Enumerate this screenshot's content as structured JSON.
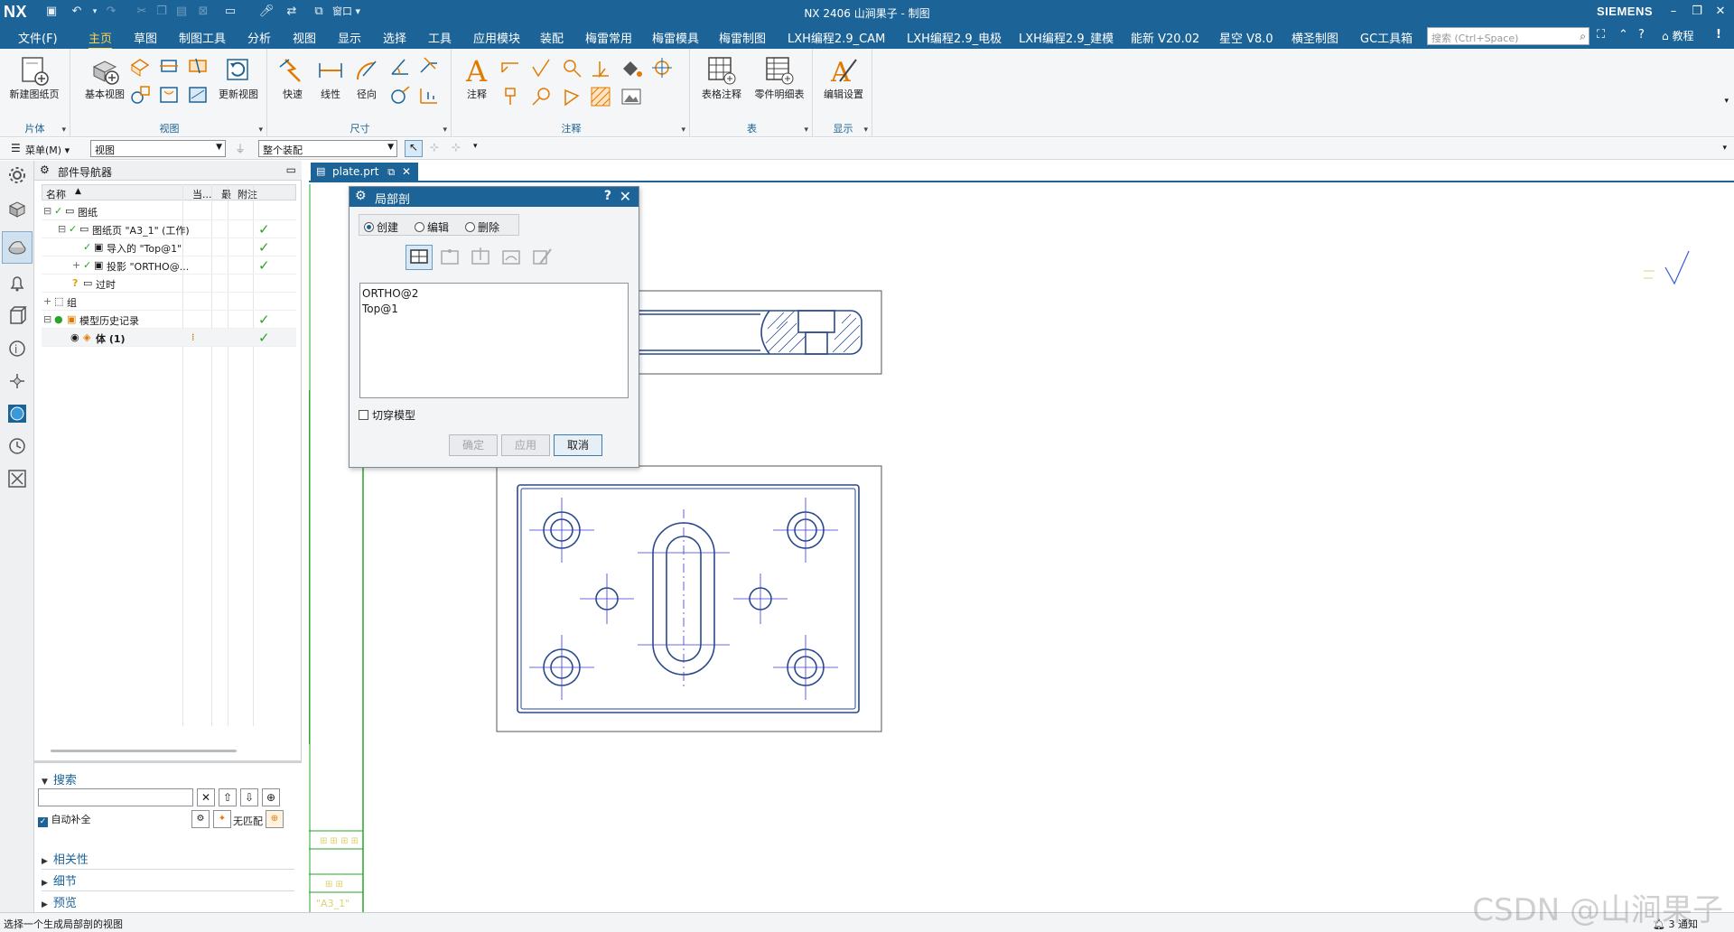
{
  "app": {
    "logo": "NX",
    "window_title": "NX 2406 山涧果子 - 制图",
    "brand": "SIEMENS",
    "window_menu": "窗口",
    "colors": {
      "primary": "#1c6497",
      "accent": "#ffd24a",
      "check": "#2aa32a",
      "drawing": "#2a4a8a",
      "view_border": "#555555"
    }
  },
  "menubar": {
    "items": [
      "文件(F)",
      "主页",
      "草图",
      "制图工具",
      "分析",
      "视图",
      "显示",
      "选择",
      "工具",
      "应用模块",
      "装配",
      "梅雷常用",
      "梅雷模具",
      "梅雷制图",
      "LXH编程2.9_CAM",
      "LXH编程2.9_电极",
      "LXH编程2.9_建模",
      "能新 V20.02",
      "星空 V8.0",
      "横圣制图",
      "GC工具箱"
    ],
    "active": "主页",
    "search_placeholder": "搜索 (Ctrl+Space)",
    "tutorial": "教程"
  },
  "ribbon": {
    "groups": [
      {
        "label": "片体",
        "buttons": [
          "新建图纸页"
        ]
      },
      {
        "label": "视图",
        "buttons": [
          "基本视图",
          "更新视图"
        ]
      },
      {
        "label": "尺寸",
        "buttons": [
          "快速",
          "线性",
          "径向"
        ]
      },
      {
        "label": "注释",
        "buttons": [
          "注释"
        ]
      },
      {
        "label": "表",
        "buttons": [
          "表格注释",
          "零件明细表"
        ]
      },
      {
        "label": "显示",
        "buttons": [
          "编辑设置"
        ]
      }
    ]
  },
  "toolbar2": {
    "menu": "菜单(M)",
    "filter": "视图",
    "scope": "整个装配"
  },
  "navigator": {
    "title": "部件导航器",
    "columns": [
      "名称",
      "当...",
      "最",
      "附注"
    ],
    "rows": [
      {
        "label": "图纸",
        "check": true
      },
      {
        "label": "图纸页 \"A3_1\" (工作)",
        "check": true
      },
      {
        "label": "导入的 \"Top@1\"",
        "check": true
      },
      {
        "label": "投影 \"ORTHO@...",
        "check": true
      },
      {
        "label": "过时",
        "check": false
      },
      {
        "label": "组",
        "check": false
      },
      {
        "label": "模型历史记录",
        "check": true
      },
      {
        "label": "体 (1)",
        "check": true
      }
    ],
    "search": {
      "title": "搜索",
      "autocomplete": "自动补全",
      "nomatch": "无匹配"
    },
    "sections": [
      "相关性",
      "细节",
      "预览"
    ]
  },
  "graphics": {
    "tab": "plate.prt",
    "sheet_label": "\"A3_1\""
  },
  "dialog": {
    "title": "局部剖",
    "help": "?",
    "modes": [
      "创建",
      "编辑",
      "删除"
    ],
    "selected_mode": "创建",
    "views": [
      "ORTHO@2",
      "Top@1"
    ],
    "cut_model": "切穿模型",
    "buttons": {
      "ok": "确定",
      "apply": "应用",
      "cancel": "取消"
    }
  },
  "status": {
    "message": "选择一个生成局部剖的视图",
    "notifications": "3 通知"
  },
  "watermark": "CSDN @山涧果子"
}
